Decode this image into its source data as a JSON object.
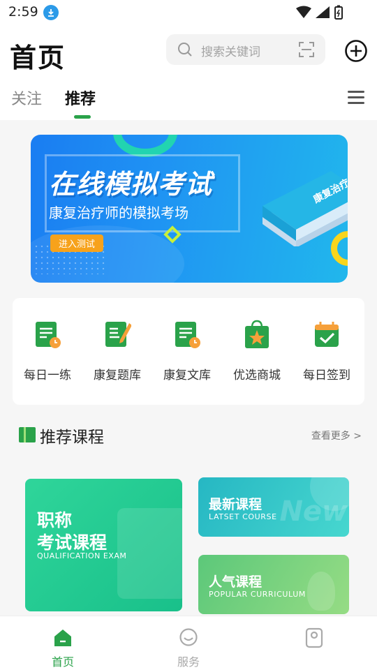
{
  "status_bar": {
    "time": "2:59"
  },
  "header": {
    "title": "首页",
    "search_placeholder": "搜索关键词",
    "tabs": [
      {
        "label": "关注",
        "active": false
      },
      {
        "label": "推荐",
        "active": true
      }
    ]
  },
  "banner": {
    "title": "在线模拟考试",
    "subtitle": "康复治疗师的模拟考场",
    "button_label": "进入测试",
    "book_text": "康复治疗"
  },
  "quick_entries": [
    {
      "label": "每日一练",
      "icon": "daily-practice-icon"
    },
    {
      "label": "康复题库",
      "icon": "question-bank-icon"
    },
    {
      "label": "康复文库",
      "icon": "document-library-icon"
    },
    {
      "label": "优选商城",
      "icon": "shopping-bag-icon"
    },
    {
      "label": "每日签到",
      "icon": "calendar-check-icon"
    }
  ],
  "section": {
    "title": "推荐课程",
    "more_label": "查看更多 >"
  },
  "courses": {
    "main": {
      "title_line1": "职称",
      "title_line2": "考试课程",
      "subtitle": "QUALIFICATION EXAM"
    },
    "latest": {
      "title": "最新课程",
      "subtitle": "LATSET COURSE",
      "deco_text": "New"
    },
    "popular": {
      "title": "人气课程",
      "subtitle": "POPULAR CURRICULUM"
    }
  },
  "bottom_nav": [
    {
      "label": "首页",
      "active": true
    },
    {
      "label": "服务",
      "active": false
    },
    {
      "label": "",
      "active": false
    }
  ],
  "colors": {
    "brand_green": "#2aa24a",
    "banner_blue": "#1f93f3",
    "accent_orange": "#f7a21b"
  }
}
